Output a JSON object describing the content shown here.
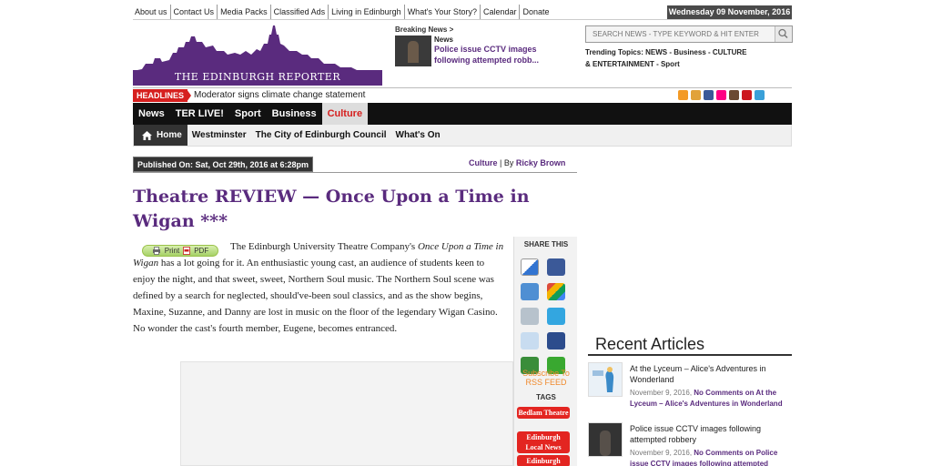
{
  "topnav": [
    "About us",
    "Contact Us",
    "Media Packs",
    "Classified Ads",
    "Living in Edinburgh",
    "What's Your Story?",
    "Calendar",
    "Donate"
  ],
  "date": "Wednesday 09 November, 2016",
  "logo_text": "THE EDINBURGH REPORTER",
  "breaking": {
    "label": "Breaking News >",
    "category": "News",
    "title": "Police issue CCTV images following attempted robb..."
  },
  "search": {
    "placeholder": "SEARCH NEWS - TYPE KEYWORD & HIT ENTER"
  },
  "trending": {
    "label": "Trending Topics:",
    "items": "NEWS - Business - CULTURE & ENTERTAINMENT - Sport"
  },
  "headlines": {
    "label": "HEADLINES",
    "text": "Moderator signs climate change statement"
  },
  "colors": {
    "brand_purple": "#5a2b7e",
    "accent_red": "#d6201f",
    "nav_black": "#111111"
  },
  "mainnav": [
    {
      "label": "News"
    },
    {
      "label": "TER LIVE!"
    },
    {
      "label": "Sport"
    },
    {
      "label": "Business"
    },
    {
      "label": "Culture",
      "active": true
    }
  ],
  "subnav": {
    "home": "Home",
    "items": [
      "Westminster",
      "The City of Edinburgh Council",
      "What's On"
    ]
  },
  "article": {
    "published": "Published On: Sat, Oct 29th, 2016 at 6:28pm",
    "category": "Culture",
    "by": "By",
    "author": "Ricky Brown",
    "title": "Theatre REVIEW — Once Upon a Time in Wigan ***",
    "print_label": "Print",
    "pdf_label": "PDF",
    "body_start": "The Edinburgh University Theatre Company's ",
    "body_italic": "Once Upon a Time in Wigan",
    "body_rest": " has a lot going for it. An enthusiastic young cast, an audience of students keen to enjoy the night, and that sweet, sweet, Northern Soul music. The Northern Soul scene was defined by a search for neglected, should've-been soul classics, and as the show begins, Maxine, Suzanne, and Danny are lost in music on the floor of the legendary Wigan Casino. No wonder the cast's fourth member, Eugene, becomes entranced."
  },
  "share": {
    "title": "SHARE THIS",
    "icons": [
      "delicious-icon",
      "facebook-icon",
      "friendfeed-icon",
      "google-icon",
      "digg-icon",
      "twitter-icon",
      "reddit-icon",
      "myspace-icon",
      "stumbleupon-icon",
      "technorati-icon"
    ],
    "rss": "Subscribe To RSS FEED",
    "tags_title": "TAGS",
    "tags": [
      "Bedlam Theatre",
      "Edinburgh Local News",
      "Edinburgh"
    ]
  },
  "recent": {
    "title": "Recent Articles",
    "items": [
      {
        "title": "At the Lyceum – Alice's Adventures in Wonderland",
        "date": "November 9, 2016,",
        "comments": "No Comments on At the Lyceum – Alice's Adventures in Wonderland"
      },
      {
        "title": "Police issue CCTV images following attempted robbery",
        "date": "November 9, 2016,",
        "comments": "No Comments on Police issue CCTV images following attempted"
      }
    ]
  }
}
